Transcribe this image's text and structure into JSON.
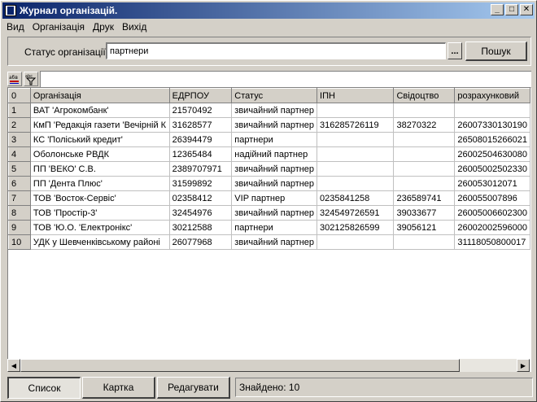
{
  "window": {
    "title": "Журнал організацій."
  },
  "titlebar_buttons": {
    "minimize": "_",
    "maximize": "□",
    "close": "✕"
  },
  "menu": [
    "Вид",
    "Організація",
    "Друк",
    "Вихід"
  ],
  "filter": {
    "label": "Статус організації:",
    "value": "партнери",
    "browse_label": "...",
    "search_label": "Пошук"
  },
  "toolbar": {
    "sort_icon_label": "абв",
    "filter_icon_label": "abc"
  },
  "table": {
    "columns": [
      "0",
      "Організація",
      "ЕДРПОУ",
      "Статус",
      "ІПН",
      "Свідоцтво",
      "розрахунковий"
    ],
    "rows": [
      [
        "1",
        "ВАТ 'Агрокомбанк'",
        "21570492",
        "звичайний партнер",
        "",
        "",
        ""
      ],
      [
        "2",
        "КмП 'Редакція газети 'Вечірній К",
        "31628577",
        "звичайний партнер",
        "316285726119",
        "38270322",
        "26007330130190"
      ],
      [
        "3",
        "КС 'Поліський кредит'",
        "26394479",
        "партнери",
        "",
        "",
        "26508015266021"
      ],
      [
        "4",
        "Оболонське РВДК",
        "12365484",
        "надійний партнер",
        "",
        "",
        "26002504630080"
      ],
      [
        "5",
        "ПП 'ВЕКО' С.В.",
        "2389707971",
        "звичайний партнер",
        "",
        "",
        "26005002502330"
      ],
      [
        "6",
        "ПП 'Дента Плюс'",
        "31599892",
        "звичайний партнер",
        "",
        "",
        "260053012071"
      ],
      [
        "7",
        "ТОВ 'Восток-Сервіс'",
        "02358412",
        "VIP партнер",
        "0235841258",
        "236589741",
        "260055007896"
      ],
      [
        "8",
        "ТОВ 'Простір-3'",
        "32454976",
        "звичайний партнер",
        "324549726591",
        "39033677",
        "26005006602300"
      ],
      [
        "9",
        "ТОВ 'Ю.О. 'Електронікс'",
        "30212588",
        "партнери",
        "302125826599",
        "39056121",
        "26002002596000"
      ],
      [
        "10",
        "УДК у Шевченківському районі",
        "26077968",
        "звичайний партнер",
        "",
        "",
        "31118050800017"
      ]
    ]
  },
  "bottom": {
    "list_label": "Список",
    "card_label": "Картка",
    "edit_label": "Редагувати",
    "found_label": "Знайдено:",
    "found_count": "10"
  }
}
